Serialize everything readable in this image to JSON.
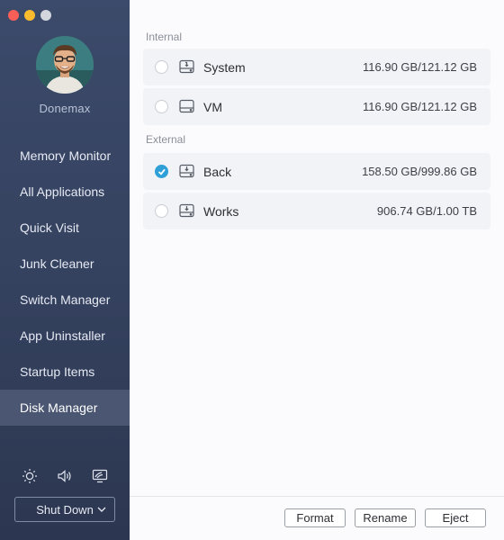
{
  "window": {
    "controls": [
      "close",
      "minimize",
      "maximize"
    ]
  },
  "sidebar": {
    "username": "Donemax",
    "items": [
      {
        "label": "Memory Monitor"
      },
      {
        "label": "All Applications"
      },
      {
        "label": "Quick Visit"
      },
      {
        "label": "Junk Cleaner"
      },
      {
        "label": "Switch Manager"
      },
      {
        "label": "App Uninstaller"
      },
      {
        "label": "Startup Items"
      },
      {
        "label": "Disk Manager",
        "active": true
      }
    ],
    "tools": [
      "brightness-icon",
      "volume-icon",
      "display-icon"
    ],
    "shutdown": {
      "label": "Shut Down"
    }
  },
  "main": {
    "sections": {
      "internal": "Internal",
      "external": "External"
    },
    "disks": [
      {
        "name": "System",
        "used": "116.90 GB",
        "total": "121.12 GB",
        "checked": false
      },
      {
        "name": "VM",
        "used": "116.90 GB",
        "total": "121.12 GB",
        "checked": false
      },
      {
        "name": "Back",
        "used": "158.50 GB",
        "total": "999.86 GB",
        "checked": true
      },
      {
        "name": "Works",
        "used": "906.74 GB",
        "total": "1.00 TB",
        "checked": false
      }
    ],
    "size_separator": "/",
    "buttons": {
      "format": "Format",
      "rename": "Rename",
      "eject": "Eject"
    }
  },
  "colors": {
    "sidebar_bg": "#36435f",
    "accent": "#2f9fd8",
    "row_bg": "#f1f3f7"
  }
}
